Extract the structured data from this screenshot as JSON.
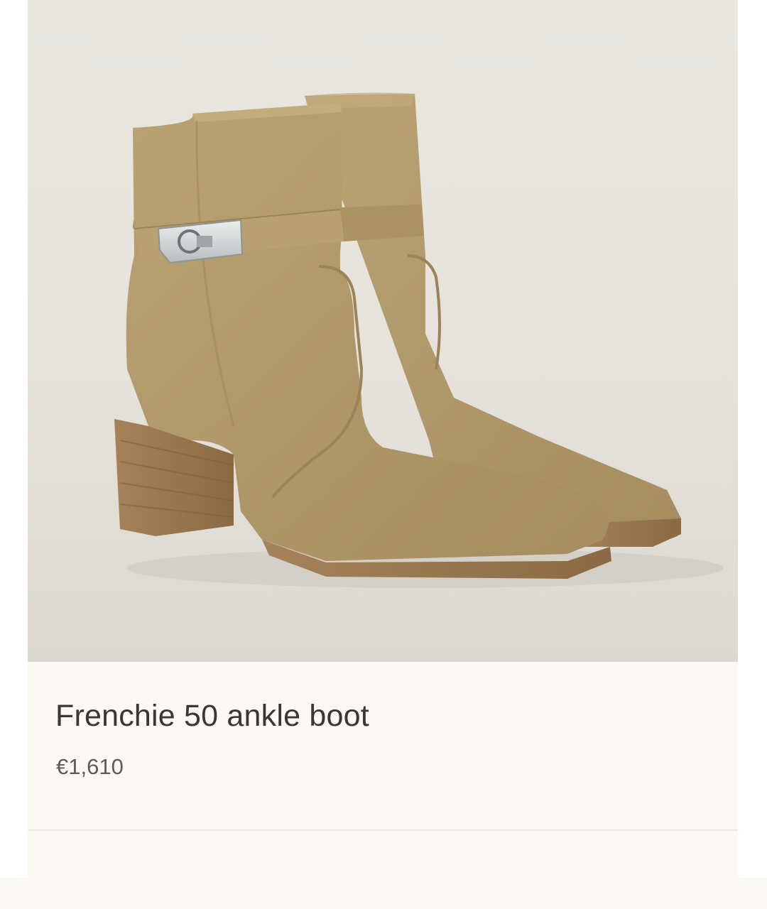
{
  "product": {
    "image_alt": "Frenchie 50 ankle boot",
    "name": "Frenchie 50 ankle boot",
    "price": "€1,610"
  },
  "next_section": {
    "left_label": "",
    "right_label": ""
  },
  "colors": {
    "background": "#fbf8f3",
    "photo_bg": "#e7e3dd",
    "suede": "#b29b6c",
    "heel_wood": "#9c7a4c",
    "buckle_silver": "#cfd2d4",
    "title_text": "#3a3633",
    "price_text": "#5f5a55"
  }
}
